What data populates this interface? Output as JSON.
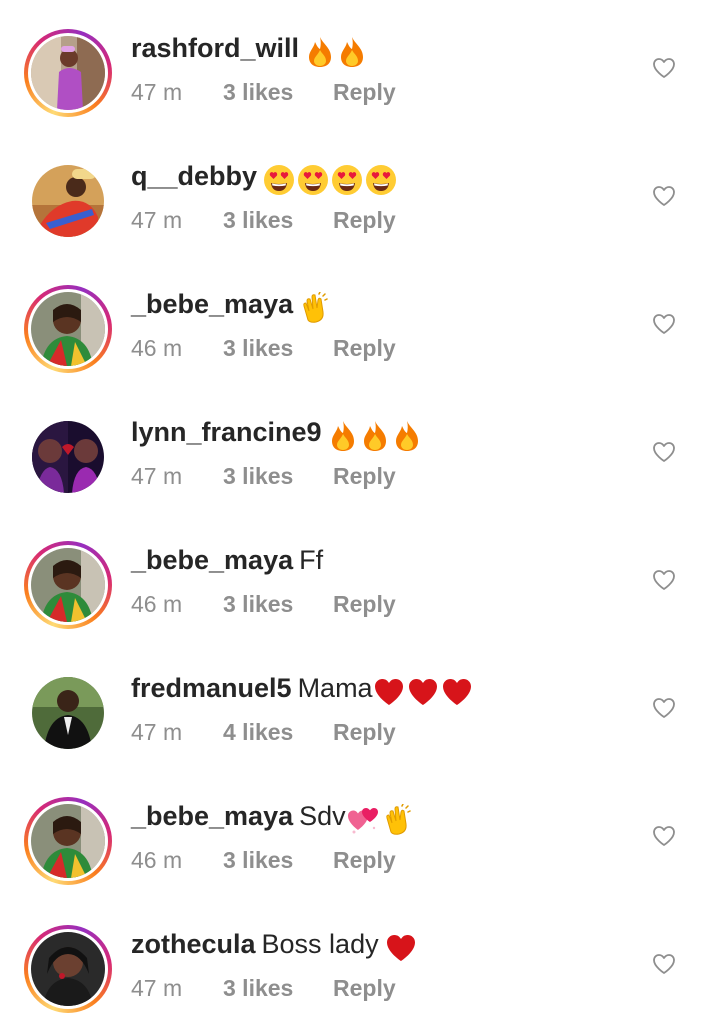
{
  "comments": [
    {
      "username": "rashford_will",
      "text": "",
      "emoji": [
        "fire",
        "fire"
      ],
      "time": "47 m",
      "likes": "3 likes",
      "reply": "Reply",
      "ring": true,
      "avatar": "a1"
    },
    {
      "username": "q__debby",
      "text": "",
      "emoji": [
        "heart-eyes",
        "heart-eyes",
        "heart-eyes",
        "heart-eyes"
      ],
      "time": "47 m",
      "likes": "3 likes",
      "reply": "Reply",
      "ring": false,
      "avatar": "a2"
    },
    {
      "username": "_bebe_maya",
      "text": "",
      "emoji": [
        "clap"
      ],
      "time": "46 m",
      "likes": "3 likes",
      "reply": "Reply",
      "ring": true,
      "avatar": "a3"
    },
    {
      "username": "lynn_francine9",
      "text": "",
      "emoji": [
        "fire",
        "fire",
        "fire"
      ],
      "time": "47 m",
      "likes": "3 likes",
      "reply": "Reply",
      "ring": false,
      "avatar": "a4"
    },
    {
      "username": "_bebe_maya",
      "text": "Ff",
      "emoji": [],
      "time": "46 m",
      "likes": "3 likes",
      "reply": "Reply",
      "ring": true,
      "avatar": "a3"
    },
    {
      "username": "fredmanuel5",
      "text": "Mama",
      "emoji": [
        "red-heart",
        "red-heart",
        "red-heart"
      ],
      "time": "47 m",
      "likes": "4 likes",
      "reply": "Reply",
      "ring": false,
      "avatar": "a6"
    },
    {
      "username": "_bebe_maya",
      "text": "Sdv",
      "emoji": [
        "two-hearts",
        "clap"
      ],
      "time": "46 m",
      "likes": "3 likes",
      "reply": "Reply",
      "ring": true,
      "avatar": "a3"
    },
    {
      "username": "zothecula",
      "text": "Boss lady",
      "emoji": [
        "red-heart"
      ],
      "time": "47 m",
      "likes": "3 likes",
      "reply": "Reply",
      "ring": true,
      "avatar": "a8"
    }
  ],
  "colors": {
    "primary_text": "#262626",
    "secondary_text": "#8e8e8e",
    "story_ring": [
      "#feda75",
      "#fa7e1e",
      "#d62976",
      "#962fbf"
    ]
  },
  "icons": {
    "like": "heart-outline-icon"
  }
}
